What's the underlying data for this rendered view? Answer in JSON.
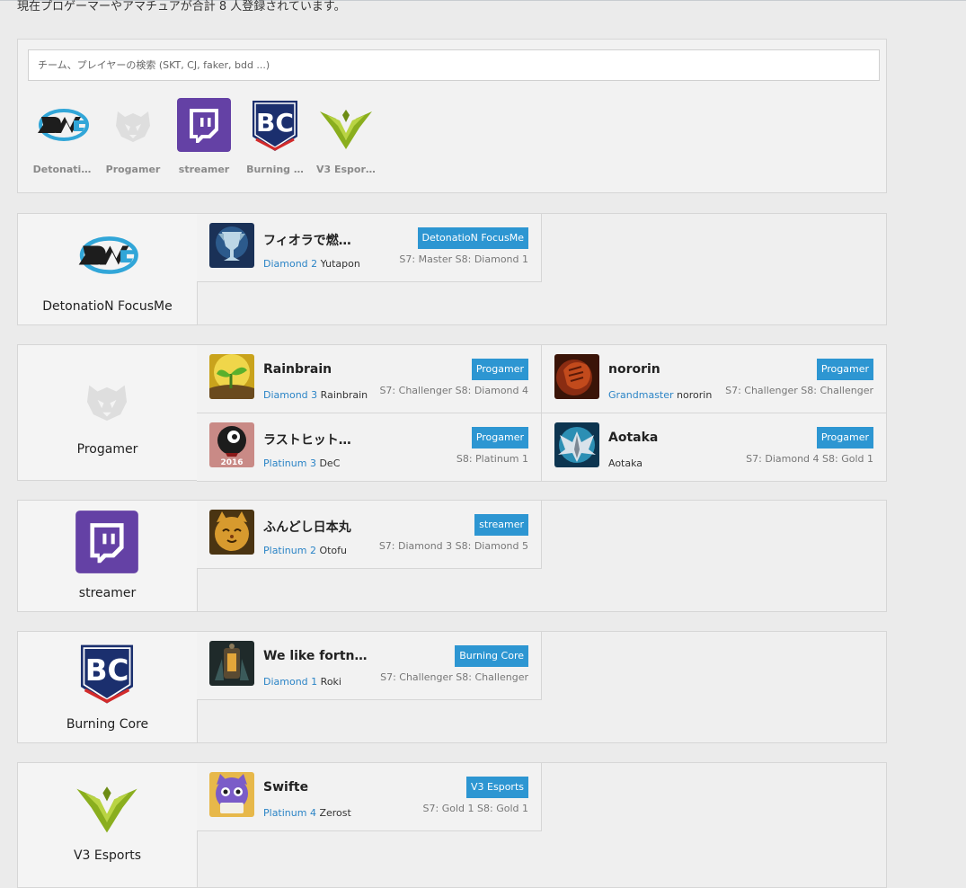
{
  "summary": "現在プロゲーマーやアマチュアが合計 8 人登録されています。",
  "search": {
    "placeholder": "チーム、プレイヤーの検索 (SKT, CJ, faker, bdd ...)"
  },
  "filters": [
    {
      "label": "Detonati…",
      "icon": "dfm-logo-icon"
    },
    {
      "label": "Progamer",
      "icon": "progamer-logo-icon"
    },
    {
      "label": "streamer",
      "icon": "twitch-logo-icon"
    },
    {
      "label": "Burning …",
      "icon": "bc-logo-icon"
    },
    {
      "label": "V3 Esports",
      "icon": "v3-logo-icon"
    }
  ],
  "teams": [
    {
      "name": "DetonatioN FocusMe",
      "players": [
        {
          "name": "フィオラで燃…",
          "rank": "Diamond 2",
          "id": "Yutapon",
          "badge": "DetonatioN FocusMe",
          "seasons": "S7: Master S8: Diamond 1",
          "avatar": "trophy-avatar-icon"
        }
      ]
    },
    {
      "name": "Progamer",
      "players": [
        {
          "name": "Rainbrain",
          "rank": "Diamond 3",
          "id": "Rainbrain",
          "badge": "Progamer",
          "seasons": "S7: Challenger S8: Diamond 4",
          "avatar": "sprout-avatar-icon"
        },
        {
          "name": "nororin",
          "rank": "Grandmaster",
          "id": "nororin",
          "badge": "Progamer",
          "seasons": "S7: Challenger S8: Challenger",
          "avatar": "fist-avatar-icon"
        },
        {
          "name": "ラストヒット…",
          "rank": "Platinum 3",
          "id": "DeC",
          "badge": "Progamer",
          "seasons": "S8: Platinum 1",
          "avatar": "poro-2016-avatar-icon"
        },
        {
          "name": "Aotaka",
          "rank": "",
          "id": "Aotaka",
          "badge": "Progamer",
          "seasons": "S7: Diamond 4 S8: Gold 1",
          "avatar": "wings-avatar-icon"
        }
      ]
    },
    {
      "name": "streamer",
      "players": [
        {
          "name": "ふんどし日本丸",
          "rank": "Platinum 2",
          "id": "Otofu",
          "badge": "streamer",
          "seasons": "S7: Diamond 3 S8: Diamond 5",
          "avatar": "cat-avatar-icon"
        }
      ]
    },
    {
      "name": "Burning Core",
      "players": [
        {
          "name": "We like fortn…",
          "rank": "Diamond 1",
          "id": "Roki",
          "badge": "Burning Core",
          "seasons": "S7: Challenger S8: Challenger",
          "avatar": "lantern-avatar-icon"
        }
      ]
    },
    {
      "name": "V3 Esports",
      "players": [
        {
          "name": "Swifte",
          "rank": "Platinum 4",
          "id": "Zerost",
          "badge": "V3 Esports",
          "seasons": "S7: Gold 1 S8: Gold 1",
          "avatar": "purple-cat-avatar-icon"
        }
      ]
    }
  ],
  "colors": {
    "accent": "#2d96d2",
    "rank": "#2b84c6",
    "twitch": "#6441a5"
  }
}
